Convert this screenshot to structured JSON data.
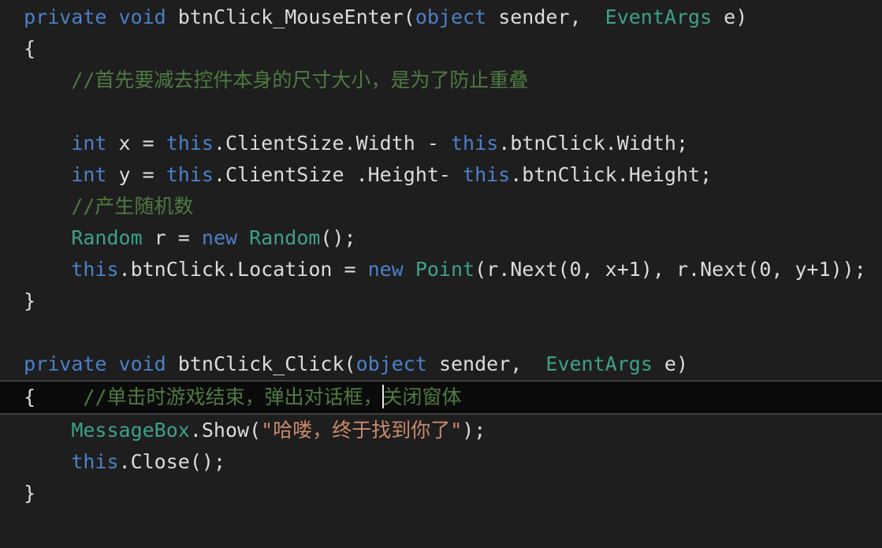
{
  "editor": {
    "name": "code-editor",
    "language": "csharp",
    "theme": "dark",
    "background_color": "#1e1e1e",
    "current_line_background": "#0b0b0b",
    "current_line_border_color": "#3f3f3f",
    "colors": {
      "plain": "#dcdcdc",
      "keyword": "#4b80c8",
      "type": "#3fa08a",
      "comment": "#4e7a42",
      "string": "#c98b6b",
      "caret": "#e8e8e8"
    },
    "caret": {
      "line_index": 12,
      "visible": true
    },
    "lines": [
      {
        "index": 0,
        "current": false,
        "indent": "",
        "tokens": [
          {
            "kind": "keyword",
            "text": "private "
          },
          {
            "kind": "keyword",
            "text": "void "
          },
          {
            "kind": "plain",
            "text": "btnClick_MouseEnter("
          },
          {
            "kind": "keyword",
            "text": "object"
          },
          {
            "kind": "plain",
            "text": " sender,  "
          },
          {
            "kind": "type",
            "text": "EventArgs"
          },
          {
            "kind": "plain",
            "text": " e)"
          }
        ]
      },
      {
        "index": 1,
        "current": false,
        "indent": "",
        "tokens": [
          {
            "kind": "plain",
            "text": "{"
          }
        ]
      },
      {
        "index": 2,
        "current": false,
        "indent": "    ",
        "tokens": [
          {
            "kind": "comment",
            "text": "//首先要减去控件本身的尺寸大小，是为了防止重叠"
          }
        ]
      },
      {
        "index": 3,
        "current": false,
        "indent": "",
        "tokens": []
      },
      {
        "index": 4,
        "current": false,
        "indent": "    ",
        "tokens": [
          {
            "kind": "keyword",
            "text": "int"
          },
          {
            "kind": "plain",
            "text": " x = "
          },
          {
            "kind": "keyword",
            "text": "this"
          },
          {
            "kind": "plain",
            "text": ".ClientSize.Width - "
          },
          {
            "kind": "keyword",
            "text": "this"
          },
          {
            "kind": "plain",
            "text": ".btnClick.Width;"
          }
        ]
      },
      {
        "index": 5,
        "current": false,
        "indent": "    ",
        "tokens": [
          {
            "kind": "keyword",
            "text": "int"
          },
          {
            "kind": "plain",
            "text": " y = "
          },
          {
            "kind": "keyword",
            "text": "this"
          },
          {
            "kind": "plain",
            "text": ".ClientSize .Height- "
          },
          {
            "kind": "keyword",
            "text": "this"
          },
          {
            "kind": "plain",
            "text": ".btnClick.Height;"
          }
        ]
      },
      {
        "index": 6,
        "current": false,
        "indent": "    ",
        "tokens": [
          {
            "kind": "comment",
            "text": "//产生随机数"
          }
        ]
      },
      {
        "index": 7,
        "current": false,
        "indent": "    ",
        "tokens": [
          {
            "kind": "type",
            "text": "Random"
          },
          {
            "kind": "plain",
            "text": " r = "
          },
          {
            "kind": "keyword",
            "text": "new"
          },
          {
            "kind": "plain",
            "text": " "
          },
          {
            "kind": "type",
            "text": "Random"
          },
          {
            "kind": "plain",
            "text": "();"
          }
        ]
      },
      {
        "index": 8,
        "current": false,
        "indent": "    ",
        "tokens": [
          {
            "kind": "keyword",
            "text": "this"
          },
          {
            "kind": "plain",
            "text": ".btnClick.Location = "
          },
          {
            "kind": "keyword",
            "text": "new"
          },
          {
            "kind": "plain",
            "text": " "
          },
          {
            "kind": "type",
            "text": "Point"
          },
          {
            "kind": "plain",
            "text": "(r.Next(0, x+1), r.Next(0, y+1));"
          }
        ]
      },
      {
        "index": 9,
        "current": false,
        "indent": "",
        "tokens": [
          {
            "kind": "plain",
            "text": "}"
          }
        ]
      },
      {
        "index": 10,
        "current": false,
        "indent": "",
        "tokens": []
      },
      {
        "index": 11,
        "current": false,
        "indent": "",
        "tokens": [
          {
            "kind": "keyword",
            "text": "private "
          },
          {
            "kind": "keyword",
            "text": "void "
          },
          {
            "kind": "plain",
            "text": "btnClick_Click("
          },
          {
            "kind": "keyword",
            "text": "object"
          },
          {
            "kind": "plain",
            "text": " sender,  "
          },
          {
            "kind": "type",
            "text": "EventArgs"
          },
          {
            "kind": "plain",
            "text": " e)"
          }
        ]
      },
      {
        "index": 12,
        "current": true,
        "indent": "",
        "tokens": [
          {
            "kind": "plain",
            "text": "{"
          },
          {
            "kind": "plain",
            "text": "    "
          },
          {
            "kind": "comment",
            "text": "//单击时游戏结束，弹出对话框，"
          },
          {
            "kind": "caret",
            "text": ""
          },
          {
            "kind": "comment",
            "text": "关闭窗体"
          }
        ]
      },
      {
        "index": 13,
        "current": false,
        "indent": "    ",
        "tokens": [
          {
            "kind": "type",
            "text": "MessageBox"
          },
          {
            "kind": "plain",
            "text": ".Show("
          },
          {
            "kind": "string",
            "text": "\"哈喽，终于找到你了\""
          },
          {
            "kind": "plain",
            "text": ");"
          }
        ]
      },
      {
        "index": 14,
        "current": false,
        "indent": "    ",
        "tokens": [
          {
            "kind": "keyword",
            "text": "this"
          },
          {
            "kind": "plain",
            "text": ".Close();"
          }
        ]
      },
      {
        "index": 15,
        "current": false,
        "indent": "",
        "tokens": [
          {
            "kind": "plain",
            "text": "}"
          }
        ]
      }
    ]
  }
}
